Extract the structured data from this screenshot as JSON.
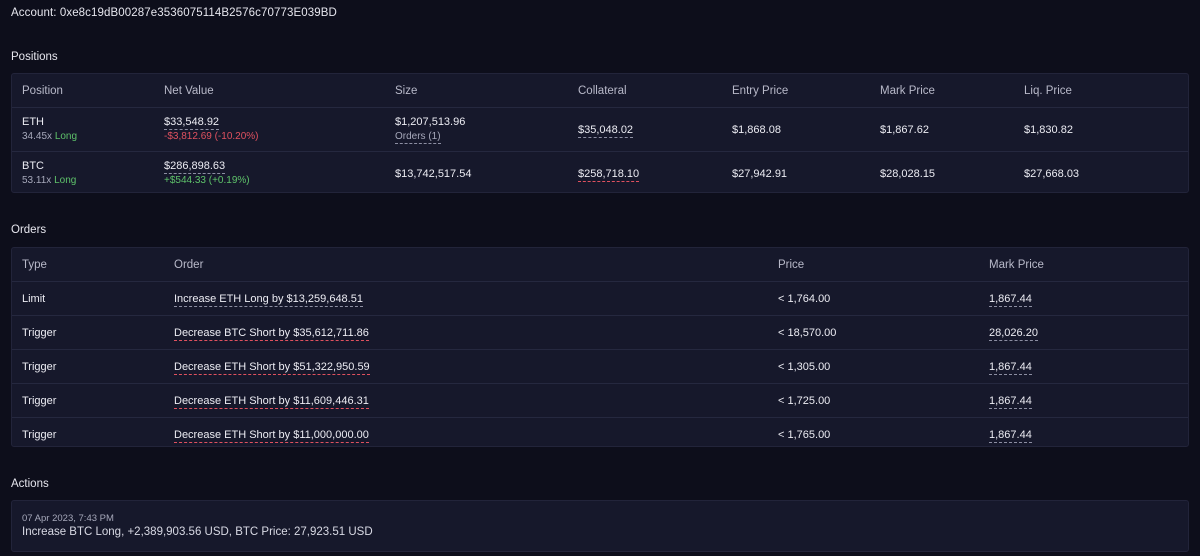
{
  "account": {
    "label": "Account: 0xe8c19dB00287e3536075114B2576c70773E039BD"
  },
  "positions": {
    "title": "Positions",
    "headers": [
      "Position",
      "Net Value",
      "Size",
      "Collateral",
      "Entry Price",
      "Mark Price",
      "Liq. Price"
    ],
    "rows": [
      {
        "symbol": "ETH",
        "leverage": "34.45x",
        "side": "Long",
        "net_value": "$33,548.92",
        "pnl": "-$3,812.69 (-10.20%)",
        "size": "$1,207,513.96",
        "orders": "Orders (1)",
        "collateral": "$35,048.02",
        "entry_price": "$1,868.08",
        "mark_price": "$1,867.62",
        "liq_price": "$1,830.82"
      },
      {
        "symbol": "BTC",
        "leverage": "53.11x",
        "side": "Long",
        "net_value": "$286,898.63",
        "pnl": "+$544.33 (+0.19%)",
        "size": "$13,742,517.54",
        "orders": "",
        "collateral": "$258,718.10",
        "entry_price": "$27,942.91",
        "mark_price": "$28,028.15",
        "liq_price": "$27,668.03"
      }
    ]
  },
  "orders": {
    "title": "Orders",
    "headers": [
      "Type",
      "Order",
      "Price",
      "Mark Price"
    ],
    "rows": [
      {
        "type": "Limit",
        "order": "Increase ETH Long by $13,259,648.51",
        "price": "< 1,764.00",
        "mark_price": "1,867.44"
      },
      {
        "type": "Trigger",
        "order": "Decrease BTC Short by $35,612,711.86",
        "price": "< 18,570.00",
        "mark_price": "28,026.20"
      },
      {
        "type": "Trigger",
        "order": "Decrease ETH Short by $51,322,950.59",
        "price": "< 1,305.00",
        "mark_price": "1,867.44"
      },
      {
        "type": "Trigger",
        "order": "Decrease ETH Short by $11,609,446.31",
        "price": "< 1,725.00",
        "mark_price": "1,867.44"
      },
      {
        "type": "Trigger",
        "order": "Decrease ETH Short by $11,000,000.00",
        "price": "< 1,765.00",
        "mark_price": "1,867.44"
      }
    ]
  },
  "actions": {
    "title": "Actions",
    "items": [
      {
        "timestamp": "07 Apr 2023, 7:43 PM",
        "text": "Increase BTC Long, +2,389,903.56 USD, BTC Price: 27,923.51 USD"
      }
    ]
  },
  "colors": {
    "background": "#0d0e1b",
    "panel": "#16182b",
    "positive": "#5ec26a",
    "negative": "#e0515f"
  }
}
